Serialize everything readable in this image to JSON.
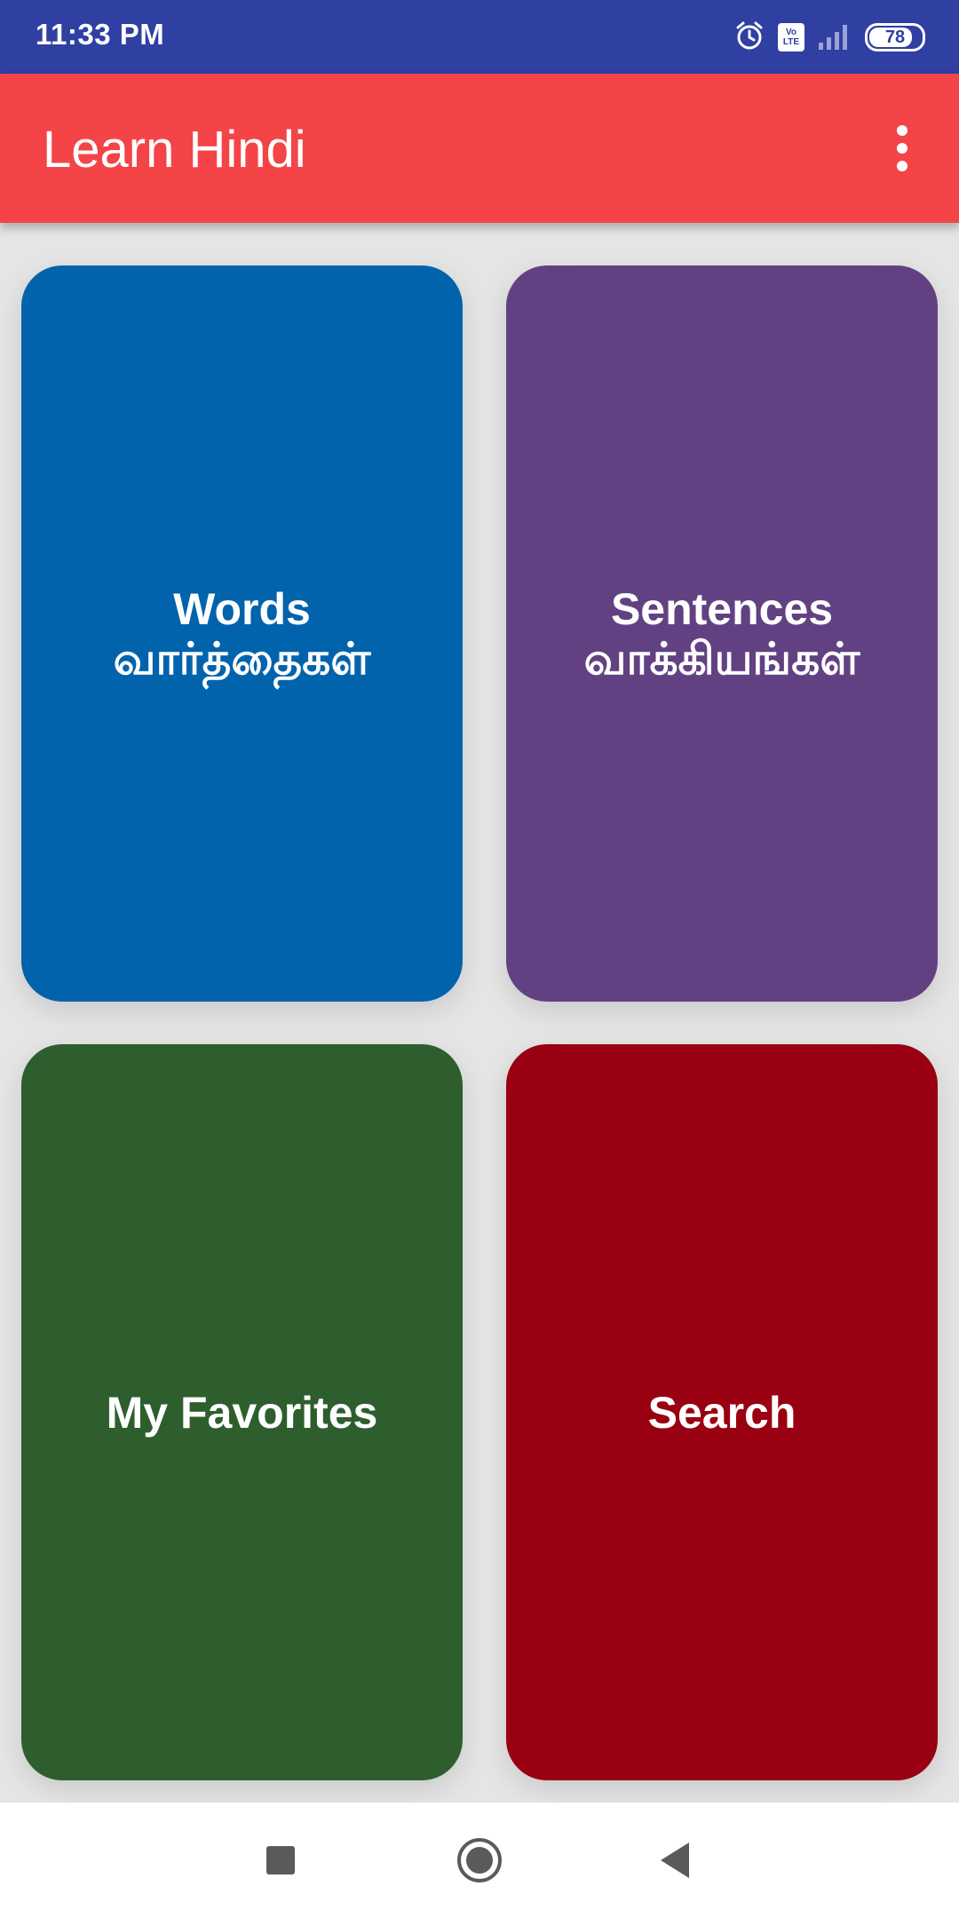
{
  "status_bar": {
    "time": "11:33 PM",
    "volte_top": "Vo",
    "volte_bottom": "LTE",
    "battery": "78",
    "icons": [
      "alarm-icon",
      "volte-icon",
      "signal-icon",
      "battery-icon"
    ]
  },
  "app_bar": {
    "title": "Learn Hindi",
    "menu_icon": "more-vert-icon"
  },
  "tiles": [
    {
      "id": "words",
      "line1": "Words",
      "line2": "வார்த்தைகள்",
      "color": "#0263ad"
    },
    {
      "id": "sentences",
      "line1": "Sentences",
      "line2": "வாக்கியங்கள்",
      "color": "#624183"
    },
    {
      "id": "favorites",
      "line1": "My Favorites",
      "color": "#2e5e2e"
    },
    {
      "id": "search",
      "line1": "Search",
      "color": "#990011"
    }
  ],
  "nav_bar": {
    "buttons": [
      "recents-icon",
      "home-icon",
      "back-icon"
    ]
  },
  "colors": {
    "status_bar": "#2f3fa2",
    "app_bar": "#f44447",
    "background": "#e5e5e5"
  }
}
